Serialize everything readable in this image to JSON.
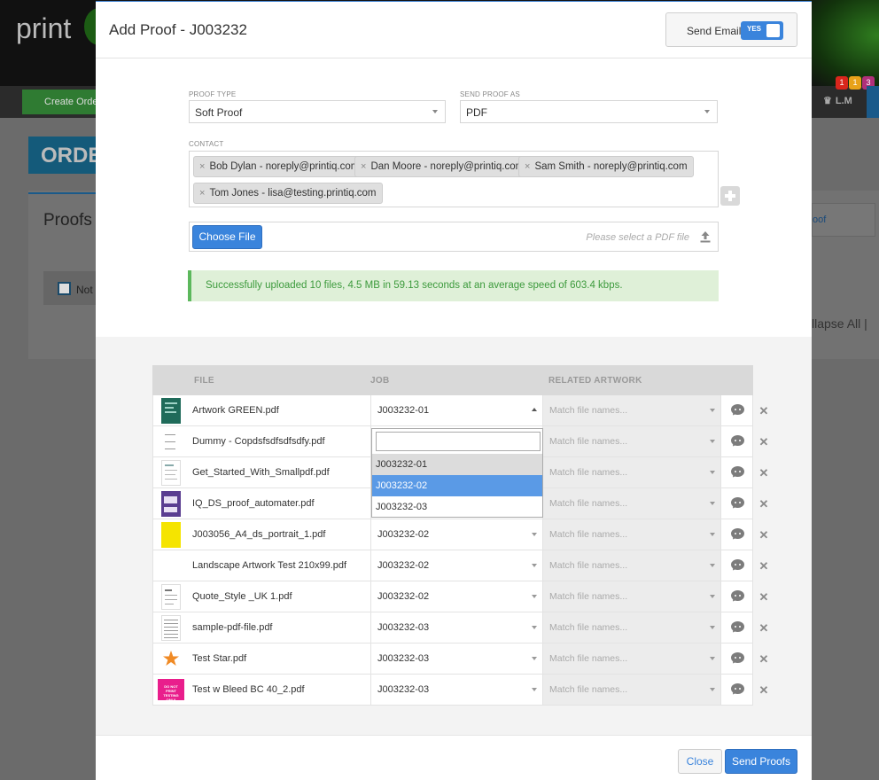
{
  "background": {
    "logo": "print",
    "create_order": "Create Order",
    "badges": [
      {
        "label": "1",
        "color": "#d9261c"
      },
      {
        "label": "1",
        "color": "#e8a21a"
      },
      {
        "label": "3",
        "color": "#b0307a"
      }
    ],
    "user_initials": "L.M",
    "order_heading": "ORDE",
    "proofs_heading": "Proofs",
    "not_label": "Not g",
    "proof_button": "oof",
    "collapse_all": "llapse All  |"
  },
  "modal": {
    "title": "Add Proof - J003232",
    "send_email": {
      "label": "Send Email",
      "toggle": "YES"
    },
    "proof_type": {
      "label": "PROOF TYPE",
      "value": "Soft Proof"
    },
    "send_proof_as": {
      "label": "SEND PROOF AS",
      "value": "PDF"
    },
    "contact": {
      "label": "CONTACT",
      "chips": [
        "Bob Dylan - noreply@printiq.com",
        "Dan Moore - noreply@printiq.com",
        "Sam Smith - noreply@printiq.com",
        "Tom Jones - lisa@testing.printiq.com"
      ]
    },
    "file_picker": {
      "button": "Choose File",
      "placeholder": "Please select a PDF file"
    },
    "success_message": "Successfully uploaded 10 files, 4.5 MB in 59.13 seconds at an average speed of 603.4 kbps.",
    "table": {
      "headers": {
        "file": "FILE",
        "job": "JOB",
        "related_artwork": "RELATED ARTWORK"
      },
      "artwork_placeholder": "Match file names...",
      "rows": [
        {
          "file": "Artwork GREEN.pdf",
          "job": "J003232-01",
          "thumb": "green"
        },
        {
          "file": "Dummy - Copdsfsdfsdfsdfy.pdf",
          "job": "",
          "thumb": "text"
        },
        {
          "file": "Get_Started_With_Smallpdf.pdf",
          "job": "",
          "thumb": "doc"
        },
        {
          "file": "IQ_DS_proof_automater.pdf",
          "job": "",
          "thumb": "purple"
        },
        {
          "file": "J003056_A4_ds_portrait_1.pdf",
          "job": "J003232-02",
          "thumb": "yellow"
        },
        {
          "file": "Landscape Artwork Test 210x99.pdf",
          "job": "J003232-02",
          "thumb": "blank"
        },
        {
          "file": "Quote_Style _UK 1.pdf",
          "job": "J003232-02",
          "thumb": "doc"
        },
        {
          "file": "sample-pdf-file.pdf",
          "job": "J003232-03",
          "thumb": "lines"
        },
        {
          "file": "Test Star.pdf",
          "job": "J003232-03",
          "thumb": "star"
        },
        {
          "file": "Test w Bleed BC 40_2.pdf",
          "job": "J003232-03",
          "thumb": "magenta"
        }
      ],
      "thumb_texts": {
        "magenta": "DO NOT PRINT TESTING ONLY"
      }
    },
    "job_dropdown": {
      "search_value": "",
      "options": [
        "J003232-01",
        "J003232-02",
        "J003232-03"
      ],
      "selected": "J003232-01",
      "highlighted": "J003232-02"
    },
    "footer": {
      "close": "Close",
      "send": "Send Proofs"
    },
    "colors": {
      "accent": "#3a84dc",
      "success_bg": "#dff0d8",
      "success_text": "#3c9a3c"
    }
  }
}
